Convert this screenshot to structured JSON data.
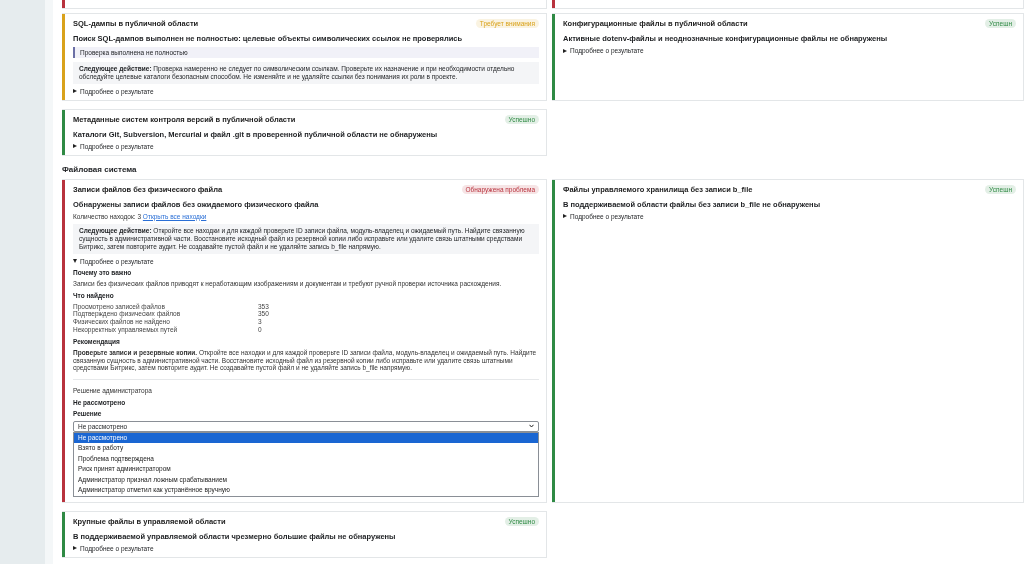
{
  "top_cards": [
    {
      "color": "#b8323d"
    },
    {
      "color": "#b8323d"
    }
  ],
  "cards": [
    {
      "title": "SQL-дампы в публичной области",
      "badge": {
        "label": "Требует внимания",
        "color": "#d9a21b"
      },
      "summary": "Поиск SQL-дампов выполнен не полностью: целевые объекты символических ссылок не проверялись",
      "note": "Проверка выполнена не полностью",
      "next_action": "**Следующее действие:** Проверка намеренно не следует по символическим ссылкам. Проверьте их назначение и при необходимости отдельно обследуйте целевые каталоги безопасным способом. Не изменяйте и не удаляйте ссылки без понимания их роли в проекте.",
      "details": {
        "label": "Подробнее о результате",
        "expanded": false
      }
    },
    {
      "title": "Конфигурационные файлы в публичной области",
      "badge": {
        "label": "Успешн",
        "color": "#2f8a44"
      },
      "summary": "Активные dotenv-файлы и неоднозначные конфигурационные файлы не обнаружены",
      "details": {
        "label": "Подробнее о результате",
        "expanded": false
      }
    },
    {
      "title": "Метаданные систем контроля версий в публичной области",
      "badge": {
        "label": "Успешно",
        "color": "#2f8a44"
      },
      "summary": "Каталоги Git, Subversion, Mercurial и файл .git в проверенной публичной области не обнаружены",
      "details": {
        "label": "Подробнее о результате",
        "expanded": false
      }
    }
  ],
  "section": {
    "title": "Файловая система",
    "cards": [
      {
        "title": "Записи файлов без физического файла",
        "badge": {
          "label": "Обнаружена проблема",
          "color": "#b8323d"
        },
        "summary": "Обнаружены записи файлов без ожидаемого физического файла",
        "count": "Количество находок: 3",
        "count_link": "Открыть все находки",
        "next_action": "**Следующее действие:** Откройте все находки и для каждой проверьте ID записи файла, модуль-владелец и ожидаемый путь. Найдите связанную сущность в административной части. Восстановите исходный файл из резервной копии либо исправьте или удалите связь штатными средствами Битрикс, затем повторите аудит. Не создавайте пустой файл и не удаляйте запись b_file напрямую.",
        "details": {
          "label": "Подробнее о результате",
          "expanded": true,
          "why_title": "Почему это важно",
          "why_text": "Записи без физических файлов приводят к неработающим изображениям и документам и требуют ручной проверки источника расхождения.",
          "found_title": "Что найдено",
          "found": [
            {
              "label": "Просмотрено записей файлов",
              "value": "353"
            },
            {
              "label": "Подтверждено физических файлов",
              "value": "350"
            },
            {
              "label": "Физических файлов не найдено",
              "value": "3"
            },
            {
              "label": "Некорректных управляемых путей",
              "value": "0"
            }
          ],
          "rec_title": "Рекомендация",
          "rec_text": "**Проверьте записи и резервные копии.** Откройте все находки и для каждой проверьте ID записи файла, модуль-владелец и ожидаемый путь. Найдите связанную сущность в административной части. Восстановите исходный файл из резервной копии либо исправьте или удалите связь штатными средствами Битрикс, затем повторите аудит. Не создавайте пустой файл и не удаляйте запись b_file напрямую."
        },
        "decision": {
          "title": "Решение администратора",
          "current": "Не рассмотрено",
          "field_label": "Решение",
          "value": "Не рассмотрено",
          "options": [
            {
              "label": "Не рассмотрено",
              "selected": true
            },
            {
              "label": "Взято в работу",
              "selected": false
            },
            {
              "label": "Проблема подтверждена",
              "selected": false
            },
            {
              "label": "Риск принят администратором",
              "selected": false
            },
            {
              "label": "Администратор признал ложным срабатыванием",
              "selected": false
            },
            {
              "label": "Администратор отметил как устранённое вручную",
              "selected": false
            }
          ]
        }
      },
      {
        "title": "Файлы управляемого хранилища без записи b_file",
        "badge": {
          "label": "Успешн",
          "color": "#2f8a44"
        },
        "summary": "В поддерживаемой области файлы без записи b_file не обнаружены",
        "details": {
          "label": "Подробнее о результате",
          "expanded": false
        }
      },
      {
        "title": "Крупные файлы в управляемой области",
        "badge": {
          "label": "Успешно",
          "color": "#2f8a44"
        },
        "summary": "В поддерживаемой управляемой области чрезмерно большие файлы не обнаружены",
        "details": {
          "label": "Подробнее о результате",
          "expanded": false
        }
      }
    ]
  }
}
